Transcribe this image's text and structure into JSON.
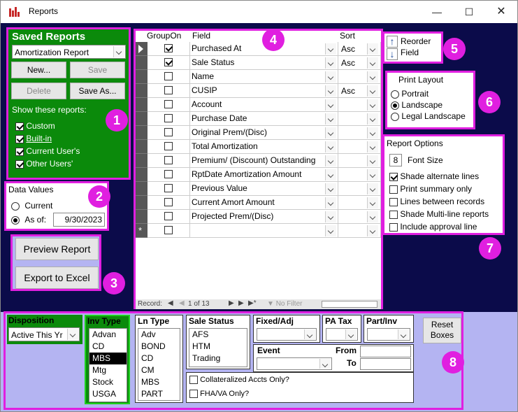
{
  "window": {
    "title": "Reports"
  },
  "saved_reports": {
    "heading": "Saved Reports",
    "selected": "Amortization Report",
    "new_label": "New...",
    "save_label": "Save",
    "delete_label": "Delete",
    "save_as_label": "Save As...",
    "show_label": "Show these reports:",
    "filters": [
      {
        "label": "Custom",
        "checked": true
      },
      {
        "label": "Built-in",
        "checked": true
      },
      {
        "label": "Current User's",
        "checked": true
      },
      {
        "label": "Other Users'",
        "checked": true
      }
    ]
  },
  "data_values": {
    "heading": "Data Values",
    "current_label": "Current",
    "as_of_label": "As of:",
    "as_of_date": "9/30/2023",
    "selected": "As of"
  },
  "actions": {
    "preview_label": "Preview Report",
    "export_label": "Export to Excel"
  },
  "grid": {
    "headers": {
      "group_on": "GroupOn",
      "field": "Field",
      "sort": "Sort"
    },
    "rows": [
      {
        "group": true,
        "field": "Purchased At",
        "sort": "Asc",
        "current": true
      },
      {
        "group": true,
        "field": "Sale Status",
        "sort": "Asc"
      },
      {
        "group": false,
        "field": "Name",
        "sort": ""
      },
      {
        "group": false,
        "field": "CUSIP",
        "sort": "Asc"
      },
      {
        "group": false,
        "field": "Account",
        "sort": ""
      },
      {
        "group": false,
        "field": "Purchase Date",
        "sort": ""
      },
      {
        "group": false,
        "field": "Original Prem/(Disc)",
        "sort": ""
      },
      {
        "group": false,
        "field": "Total Amortization",
        "sort": ""
      },
      {
        "group": false,
        "field": "Premium/ (Discount) Outstanding",
        "sort": ""
      },
      {
        "group": false,
        "field": "RptDate Amortization Amount",
        "sort": ""
      },
      {
        "group": false,
        "field": "Previous Value",
        "sort": ""
      },
      {
        "group": false,
        "field": "Current Amort Amount",
        "sort": ""
      },
      {
        "group": false,
        "field": "Projected Prem/(Disc)",
        "sort": ""
      },
      {
        "group": false,
        "field": "",
        "sort": "",
        "new": true
      }
    ],
    "record_label": "Record:",
    "record_text": "1 of 13",
    "no_filter": "No Filter",
    "new_row_marker": "*"
  },
  "reorder": {
    "label1": "Reorder",
    "label2": "Field"
  },
  "print_layout": {
    "heading": "Print Layout",
    "options": [
      "Portrait",
      "Landscape",
      "Legal Landscape"
    ],
    "selected": "Landscape"
  },
  "report_options": {
    "heading": "Report Options",
    "font_size": "8",
    "font_size_label": "Font Size",
    "options": [
      {
        "label": "Shade alternate lines",
        "checked": true
      },
      {
        "label": "Print summary only",
        "checked": false
      },
      {
        "label": "Lines between records",
        "checked": false
      },
      {
        "label": "Shade Multi-line reports",
        "checked": false
      },
      {
        "label": "Include approval line",
        "checked": false
      }
    ]
  },
  "filters": {
    "disposition": {
      "label": "Disposition",
      "value": "Active This Yr"
    },
    "inv_type": {
      "label": "Inv Type",
      "items": [
        "Advan",
        "CD",
        "MBS",
        "Mtg",
        "Stock",
        "USGA"
      ],
      "selected": "MBS"
    },
    "ln_type": {
      "label": "Ln Type",
      "items": [
        "Adv",
        "BOND",
        "CD",
        "CM",
        "MBS",
        "PART"
      ]
    },
    "sale_status": {
      "label": "Sale Status",
      "items": [
        "AFS",
        "HTM",
        "Trading"
      ]
    },
    "fixed_adj": {
      "label": "Fixed/Adj",
      "value": ""
    },
    "pa_tax": {
      "label": "PA Tax",
      "value": ""
    },
    "part_inv": {
      "label": "Part/Inv",
      "value": ""
    },
    "event": {
      "label": "Event",
      "value": ""
    },
    "from_label": "From",
    "to_label": "To",
    "collateralized_label": "Collateralized Accts Only?",
    "fha_label": "FHA/VA Only?",
    "reset_label1": "Reset",
    "reset_label2": "Boxes"
  },
  "annotations": [
    "1",
    "2",
    "3",
    "4",
    "5",
    "6",
    "7",
    "8"
  ],
  "colors": {
    "highlight": "#e01fe0",
    "panel_green": "#0b8a0b",
    "background_navy": "#0b0b4a",
    "background_lavender": "#b4b4f2"
  }
}
